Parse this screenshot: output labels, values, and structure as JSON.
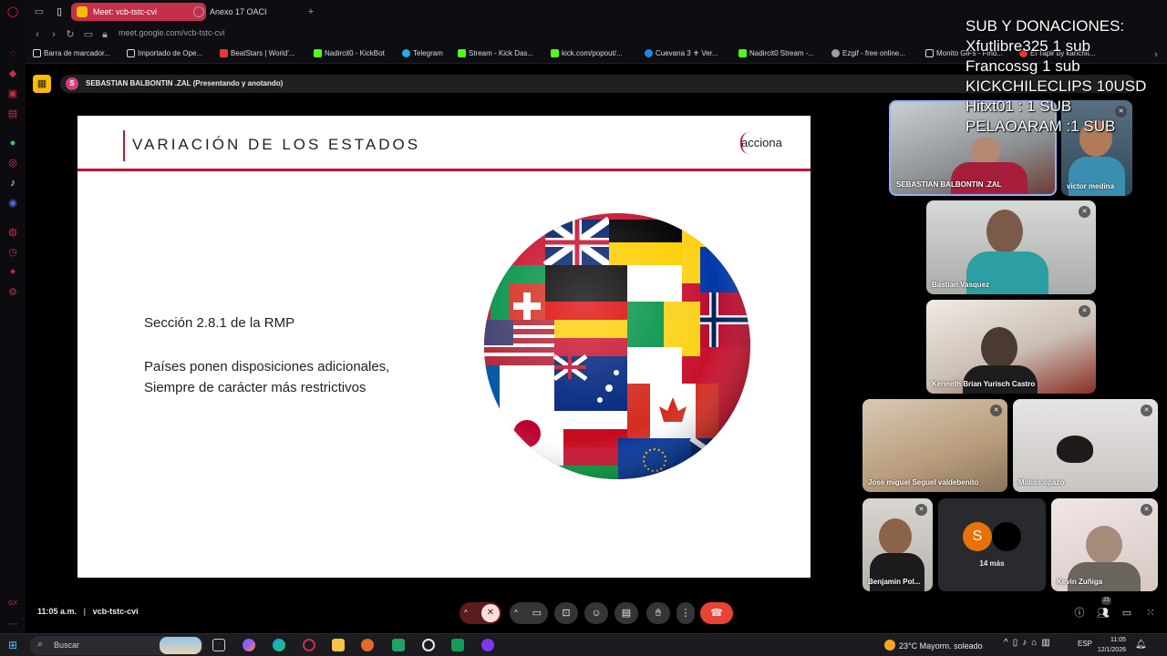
{
  "browser": {
    "tabs": [
      {
        "label": "Meet: vcb-tstc-cvi",
        "active": true
      },
      {
        "label": "Anexo 17 OACI",
        "active": false
      }
    ],
    "url": "meet.google.com/vcb-tstc-cvi",
    "bookmarks": [
      "Barra de marcador...",
      "Importado de Ope...",
      "BeatStars | World'...",
      "Nadircit0 - KickBot",
      "Telegram",
      "Stream - Kick Das...",
      "kick.com/popout/...",
      "Cuevana 3 ⚜ Ver...",
      "Nadircit0 Stream -...",
      "Ezgif - free online...",
      "Monito GIFs - Find...",
      "El Tapir by kanchit..."
    ]
  },
  "meet": {
    "presenter_initial": "S",
    "presenter_banner": "SEBASTIAN BALBONTIN .ZAL (Presentando y anotando)",
    "meeting_time": "11:05 a.m.",
    "meeting_code": "vcb-tstc-cvi",
    "more_count": "14 más",
    "more_initial": "S",
    "participants_badge": "23",
    "participants": [
      "SEBASTIAN BALBONTIN .ZAL",
      "victor medina",
      "Bastian Vasquez",
      "Kenneth Brian Yurisch Castro",
      "José miguel Seguel valdebenito",
      "Matias opazo",
      "Benjamin Pol...",
      "Kevin Zuñiga"
    ]
  },
  "slide": {
    "title": "VARIACIÓN DE LOS ESTADOS",
    "logo": "acciona",
    "line1": "Sección 2.8.1 de la RMP",
    "line2": "Países ponen disposiciones adicionales,",
    "line3": "Siempre de carácter más restrictivos"
  },
  "overlay": {
    "lines": [
      "SUB Y DONACIONES:",
      "Xfutlibre325 1 sub",
      "Francossg 1 sub",
      "KICKCHILECLIPS 10USD",
      "Hitxt01 : 1 SUB",
      "PELAOARAM :1 SUB"
    ]
  },
  "taskbar": {
    "search_label": "Buscar",
    "weather": "23°C  Mayorm. soleado",
    "language": "ESP",
    "time": "11:05",
    "date": "12/1/2026"
  },
  "colors": {
    "accent_red": "#c0152f",
    "end_call": "#ea4335",
    "presenter_pink": "#d23f7b"
  }
}
